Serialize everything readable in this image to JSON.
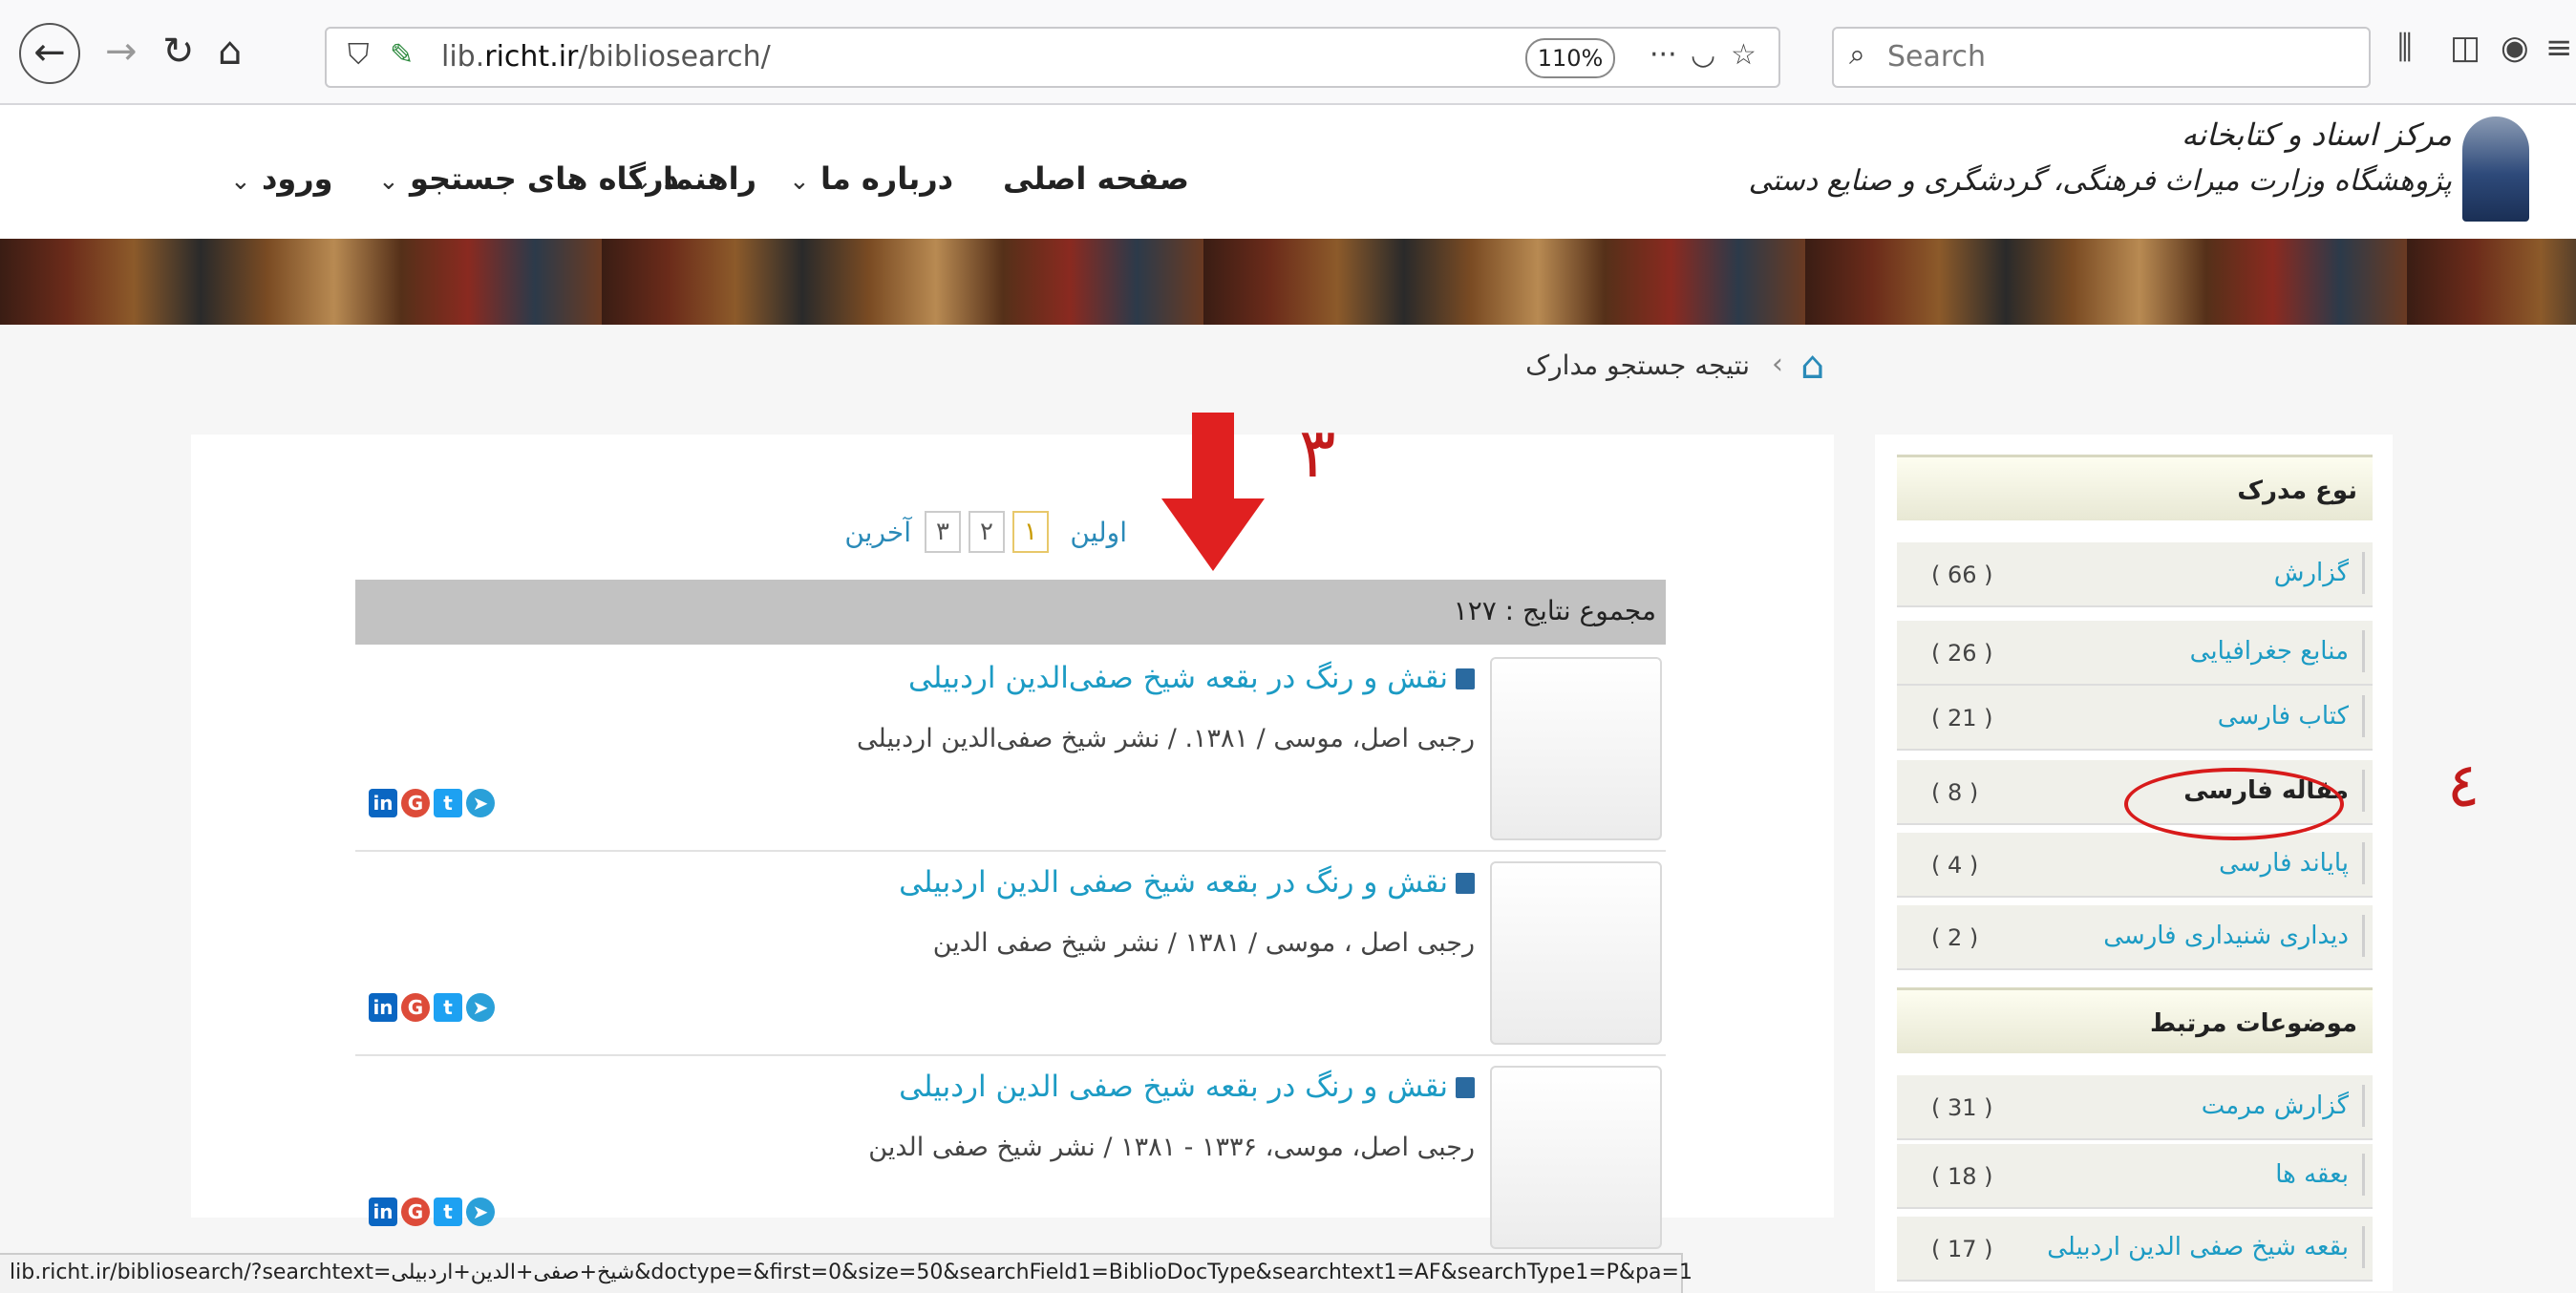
{
  "browser": {
    "url_prefix": "lib.",
    "url_domain": "richt.ir",
    "url_path": "/bibliosearch/",
    "zoom": "110%",
    "search_placeholder": "Search",
    "url_more": "···"
  },
  "site": {
    "logo_line1": "مرکز اسناد و کتابخانه",
    "logo_line2": "پژوهشگاه وزارت میراث فرهنگی، گردشگری و صنایع دستی",
    "menu": {
      "home": "صفحه اصلی",
      "about": "درباره ما",
      "guide": "راهنما",
      "portals": "درگاه های جستجو",
      "login": "ورود"
    },
    "breadcrumb": "نتیجه جستجو مدارک"
  },
  "pagination": {
    "first": "اولین",
    "pages": [
      "۱",
      "۲",
      "۳"
    ],
    "last": "آخرین"
  },
  "results": {
    "total": "مجموع نتایج : ۱۲۷",
    "items": [
      {
        "title": "نقش و رنگ در بقعه شیخ صفی‌الدین اردبیلی",
        "meta": "رجبی اصل، موسی / ۱۳۸۱. / نشر شیخ صفی‌الدین اردبیلی"
      },
      {
        "title": "نقش و رنگ در بقعه شیخ صفی الدین اردبیلی",
        "meta": "رجبی اصل ، موسی / ۱۳۸۱ / نشر شیخ صفی الدین"
      },
      {
        "title": "نقش و رنگ در بقعه شیخ صفی الدین اردبیلی",
        "meta": "رجبی اصل، موسی، ۱۳۳۶ - ۱۳۸۱ / نشر شیخ صفی الدین"
      }
    ]
  },
  "sidebar": {
    "doc_type_heading": "نوع مدرک",
    "doc_types": [
      {
        "label": "گزارش",
        "count": "( 66 )"
      },
      {
        "label": "منابع جغرافیایی",
        "count": "( 26 )"
      },
      {
        "label": "کتاب فارسی",
        "count": "( 21 )"
      },
      {
        "label": "مقاله فارسی",
        "count": "( 8 )"
      },
      {
        "label": "پایاند فارسی",
        "count": "( 4 )"
      },
      {
        "label": "دیداری شنیداری فارسی",
        "count": "( 2 )"
      }
    ],
    "related_heading": "موضوعات مرتبط",
    "related": [
      {
        "label": "گزارش مرمت",
        "count": "( 31 )"
      },
      {
        "label": "بعقه ها",
        "count": "( 18 )"
      },
      {
        "label": "بقعه شیخ صفی الدین اردبیلی",
        "count": "( 17 )"
      }
    ]
  },
  "annotations": {
    "step3": "۳",
    "step4": "٤"
  },
  "status_url": "lib.richt.ir/bibliosearch/?searchtext=شیخ+صفی+الدین+اردبیلی&doctype=&first=0&size=50&searchField1=BiblioDocType&searchtext1=AF&searchType1=P&pa=1",
  "colors": {
    "link": "#1c9bc4",
    "annotation_red": "#d81b1b",
    "total_bar": "#c2c2c2"
  }
}
